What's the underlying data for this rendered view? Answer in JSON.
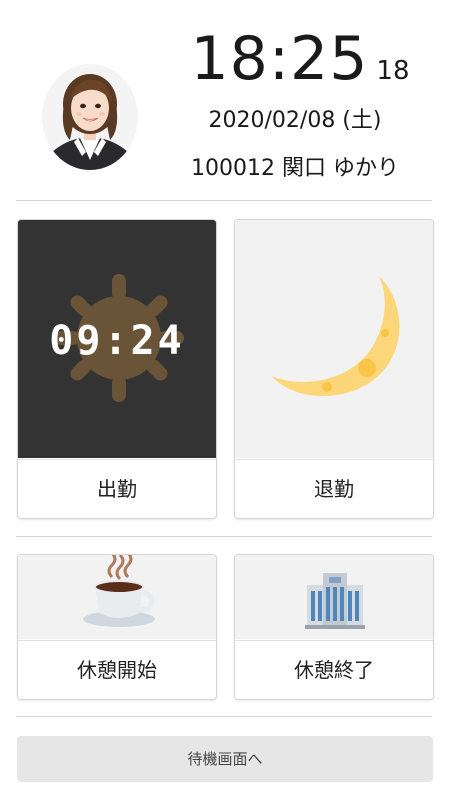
{
  "clock": {
    "hours_minutes": "18:25",
    "seconds": "18",
    "date": "2020/02/08 (土)"
  },
  "user": {
    "id_name": "100012 関口 ゆかり"
  },
  "punch_in": {
    "label": "出勤",
    "display_time": "09:24",
    "icon": "sun-icon"
  },
  "punch_out": {
    "label": "退勤",
    "icon": "moon-icon"
  },
  "break_start": {
    "label": "休憩開始",
    "icon": "coffee-cup-icon"
  },
  "break_end": {
    "label": "休憩終了",
    "icon": "office-building-icon"
  },
  "standby_button": {
    "label": "待機画面へ"
  },
  "colors": {
    "punch_in_bg": "#333333",
    "card_art_bg": "#f2f2f2",
    "sun": "#6a5437",
    "moon": "#fcd77a",
    "moon_crater": "#f8c548",
    "standby_bg": "#e6e6e6"
  }
}
